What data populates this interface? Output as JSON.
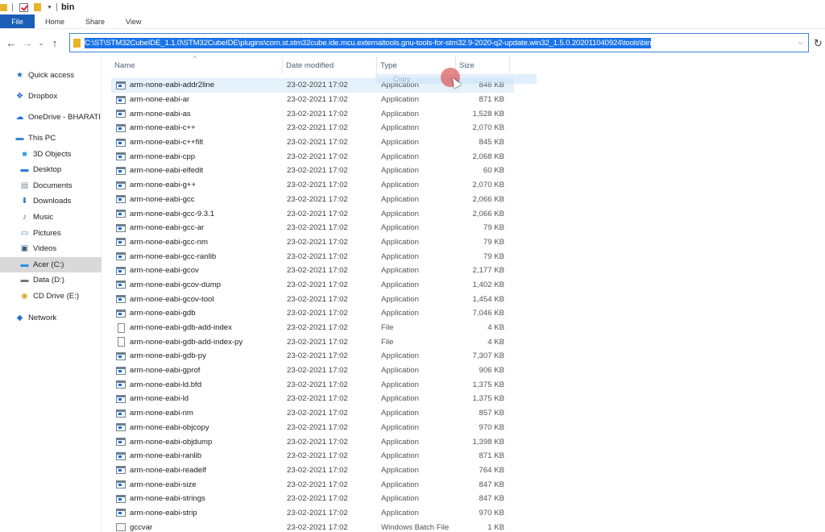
{
  "window": {
    "title": "bin"
  },
  "ribbon": {
    "tabs": [
      {
        "label": "File",
        "active": true
      },
      {
        "label": "Home"
      },
      {
        "label": "Share"
      },
      {
        "label": "View"
      }
    ]
  },
  "nav": {
    "back_icon": "arrow-left-icon",
    "forward_icon": "arrow-right-icon",
    "recent_icon": "chevron-down-icon",
    "up_icon": "arrow-up-icon",
    "address": "C:\\ST\\STM32CubeIDE_1.1.0\\STM32CubeIDE\\plugins\\com.st.stm32cube.ide.mcu.externaltools.gnu-tools-for-stm32.9-2020-q2-update.win32_1.5.0.202011040924\\tools\\bin",
    "dropdown_icon": "chevron-down-icon",
    "refresh_icon": "refresh-icon"
  },
  "sidebar": {
    "items": [
      {
        "label": "Quick access",
        "icon": "star-icon",
        "level": 0
      },
      {
        "label": "Dropbox",
        "icon": "dropbox-icon",
        "level": 0
      },
      {
        "label": "OneDrive - BHARATI",
        "icon": "cloud-icon",
        "level": 0
      },
      {
        "label": "This PC",
        "icon": "computer-icon",
        "level": 0
      },
      {
        "label": "3D Objects",
        "icon": "cube-icon",
        "level": 1
      },
      {
        "label": "Desktop",
        "icon": "desktop-icon",
        "level": 1
      },
      {
        "label": "Documents",
        "icon": "document-icon",
        "level": 1
      },
      {
        "label": "Downloads",
        "icon": "download-icon",
        "level": 1
      },
      {
        "label": "Music",
        "icon": "music-icon",
        "level": 1
      },
      {
        "label": "Pictures",
        "icon": "pictures-icon",
        "level": 1
      },
      {
        "label": "Videos",
        "icon": "videos-icon",
        "level": 1
      },
      {
        "label": "Acer (C:)",
        "icon": "windows-drive-icon",
        "level": 1,
        "selected": true
      },
      {
        "label": "Data (D:)",
        "icon": "drive-icon",
        "level": 1
      },
      {
        "label": "CD Drive (E:)",
        "icon": "cd-drive-icon",
        "level": 1
      },
      {
        "label": "Network",
        "icon": "network-icon",
        "level": 0
      }
    ]
  },
  "columns": {
    "name": "Name",
    "date": "Date modified",
    "type": "Type",
    "size": "Size",
    "sort_icon": "sort-ascending-icon"
  },
  "drag": {
    "label": "Copy"
  },
  "files": [
    {
      "name": "arm-none-eabi-addr2line",
      "date": "23-02-2021 17:02",
      "type": "Application",
      "size": "846 KB",
      "kind": "app",
      "highlighted": true
    },
    {
      "name": "arm-none-eabi-ar",
      "date": "23-02-2021 17:02",
      "type": "Application",
      "size": "871 KB",
      "kind": "app"
    },
    {
      "name": "arm-none-eabi-as",
      "date": "23-02-2021 17:02",
      "type": "Application",
      "size": "1,528 KB",
      "kind": "app"
    },
    {
      "name": "arm-none-eabi-c++",
      "date": "23-02-2021 17:02",
      "type": "Application",
      "size": "2,070 KB",
      "kind": "app"
    },
    {
      "name": "arm-none-eabi-c++filt",
      "date": "23-02-2021 17:02",
      "type": "Application",
      "size": "845 KB",
      "kind": "app"
    },
    {
      "name": "arm-none-eabi-cpp",
      "date": "23-02-2021 17:02",
      "type": "Application",
      "size": "2,068 KB",
      "kind": "app"
    },
    {
      "name": "arm-none-eabi-elfedit",
      "date": "23-02-2021 17:02",
      "type": "Application",
      "size": "60 KB",
      "kind": "app"
    },
    {
      "name": "arm-none-eabi-g++",
      "date": "23-02-2021 17:02",
      "type": "Application",
      "size": "2,070 KB",
      "kind": "app"
    },
    {
      "name": "arm-none-eabi-gcc",
      "date": "23-02-2021 17:02",
      "type": "Application",
      "size": "2,066 KB",
      "kind": "app"
    },
    {
      "name": "arm-none-eabi-gcc-9.3.1",
      "date": "23-02-2021 17:02",
      "type": "Application",
      "size": "2,066 KB",
      "kind": "app"
    },
    {
      "name": "arm-none-eabi-gcc-ar",
      "date": "23-02-2021 17:02",
      "type": "Application",
      "size": "79 KB",
      "kind": "app"
    },
    {
      "name": "arm-none-eabi-gcc-nm",
      "date": "23-02-2021 17:02",
      "type": "Application",
      "size": "79 KB",
      "kind": "app"
    },
    {
      "name": "arm-none-eabi-gcc-ranlib",
      "date": "23-02-2021 17:02",
      "type": "Application",
      "size": "79 KB",
      "kind": "app"
    },
    {
      "name": "arm-none-eabi-gcov",
      "date": "23-02-2021 17:02",
      "type": "Application",
      "size": "2,177 KB",
      "kind": "app"
    },
    {
      "name": "arm-none-eabi-gcov-dump",
      "date": "23-02-2021 17:02",
      "type": "Application",
      "size": "1,402 KB",
      "kind": "app"
    },
    {
      "name": "arm-none-eabi-gcov-tool",
      "date": "23-02-2021 17:02",
      "type": "Application",
      "size": "1,454 KB",
      "kind": "app"
    },
    {
      "name": "arm-none-eabi-gdb",
      "date": "23-02-2021 17:02",
      "type": "Application",
      "size": "7,046 KB",
      "kind": "app"
    },
    {
      "name": "arm-none-eabi-gdb-add-index",
      "date": "23-02-2021 17:02",
      "type": "File",
      "size": "4 KB",
      "kind": "file"
    },
    {
      "name": "arm-none-eabi-gdb-add-index-py",
      "date": "23-02-2021 17:02",
      "type": "File",
      "size": "4 KB",
      "kind": "file"
    },
    {
      "name": "arm-none-eabi-gdb-py",
      "date": "23-02-2021 17:02",
      "type": "Application",
      "size": "7,307 KB",
      "kind": "app"
    },
    {
      "name": "arm-none-eabi-gprof",
      "date": "23-02-2021 17:02",
      "type": "Application",
      "size": "906 KB",
      "kind": "app"
    },
    {
      "name": "arm-none-eabi-ld.bfd",
      "date": "23-02-2021 17:02",
      "type": "Application",
      "size": "1,375 KB",
      "kind": "app"
    },
    {
      "name": "arm-none-eabi-ld",
      "date": "23-02-2021 17:02",
      "type": "Application",
      "size": "1,375 KB",
      "kind": "app"
    },
    {
      "name": "arm-none-eabi-nm",
      "date": "23-02-2021 17:02",
      "type": "Application",
      "size": "857 KB",
      "kind": "app"
    },
    {
      "name": "arm-none-eabi-objcopy",
      "date": "23-02-2021 17:02",
      "type": "Application",
      "size": "970 KB",
      "kind": "app"
    },
    {
      "name": "arm-none-eabi-objdump",
      "date": "23-02-2021 17:02",
      "type": "Application",
      "size": "1,398 KB",
      "kind": "app"
    },
    {
      "name": "arm-none-eabi-ranlib",
      "date": "23-02-2021 17:02",
      "type": "Application",
      "size": "871 KB",
      "kind": "app"
    },
    {
      "name": "arm-none-eabi-readelf",
      "date": "23-02-2021 17:02",
      "type": "Application",
      "size": "764 KB",
      "kind": "app"
    },
    {
      "name": "arm-none-eabi-size",
      "date": "23-02-2021 17:02",
      "type": "Application",
      "size": "847 KB",
      "kind": "app"
    },
    {
      "name": "arm-none-eabi-strings",
      "date": "23-02-2021 17:02",
      "type": "Application",
      "size": "847 KB",
      "kind": "app"
    },
    {
      "name": "arm-none-eabi-strip",
      "date": "23-02-2021 17:02",
      "type": "Application",
      "size": "970 KB",
      "kind": "app"
    },
    {
      "name": "gccvar",
      "date": "23-02-2021 17:02",
      "type": "Windows Batch File",
      "size": "1 KB",
      "kind": "bat"
    }
  ]
}
